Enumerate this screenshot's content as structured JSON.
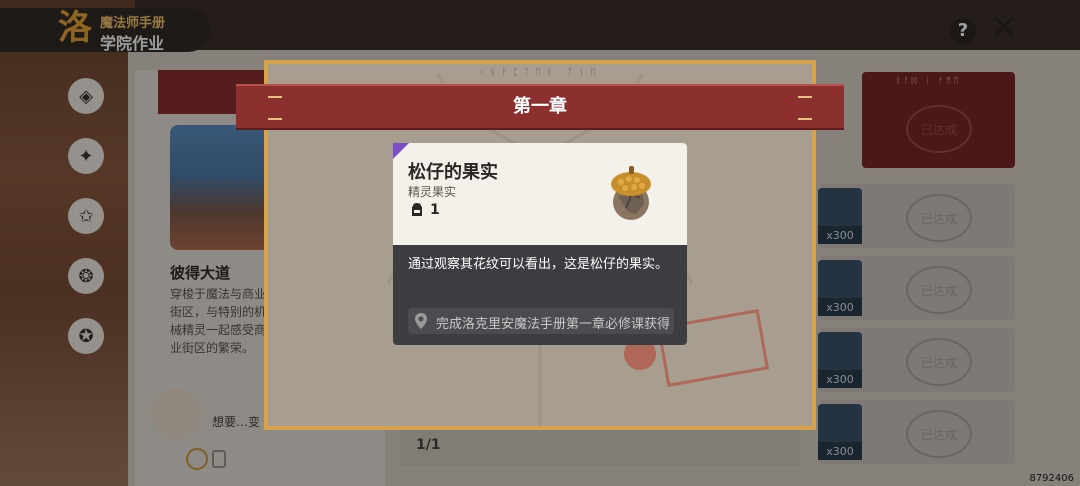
{
  "header": {
    "logo_char": "洛",
    "line1": "魔法师手册",
    "line2": "学院作业",
    "help_label": "?",
    "close_label": "✕"
  },
  "background": {
    "location_title": "彼得大道",
    "location_desc": "穿梭于魔法与商业街区，与特别的机械精灵一起感受商业街区的繁荣。",
    "npc_hint": "想要…变",
    "page_indicator": "1/1",
    "build_id": "8792406",
    "reward_badge": "x300",
    "stamp_label": "已达成",
    "red_card_runes": "ᚱᚨᛞ ᛁ ᚨᛗᛖ"
  },
  "chapter": {
    "runes": "ᚲᚺᚨᛈᛏᛖᚱ ᚩᚾᛖ",
    "title": "第一章"
  },
  "item": {
    "name": "松仔的果实",
    "category": "精灵果实",
    "count": "1",
    "description": "通过观察其花纹可以看出，这是松仔的果实。",
    "source": "完成洛克里安魔法手册第一章必修课获得",
    "rarity_color": "#7c4ec9"
  }
}
